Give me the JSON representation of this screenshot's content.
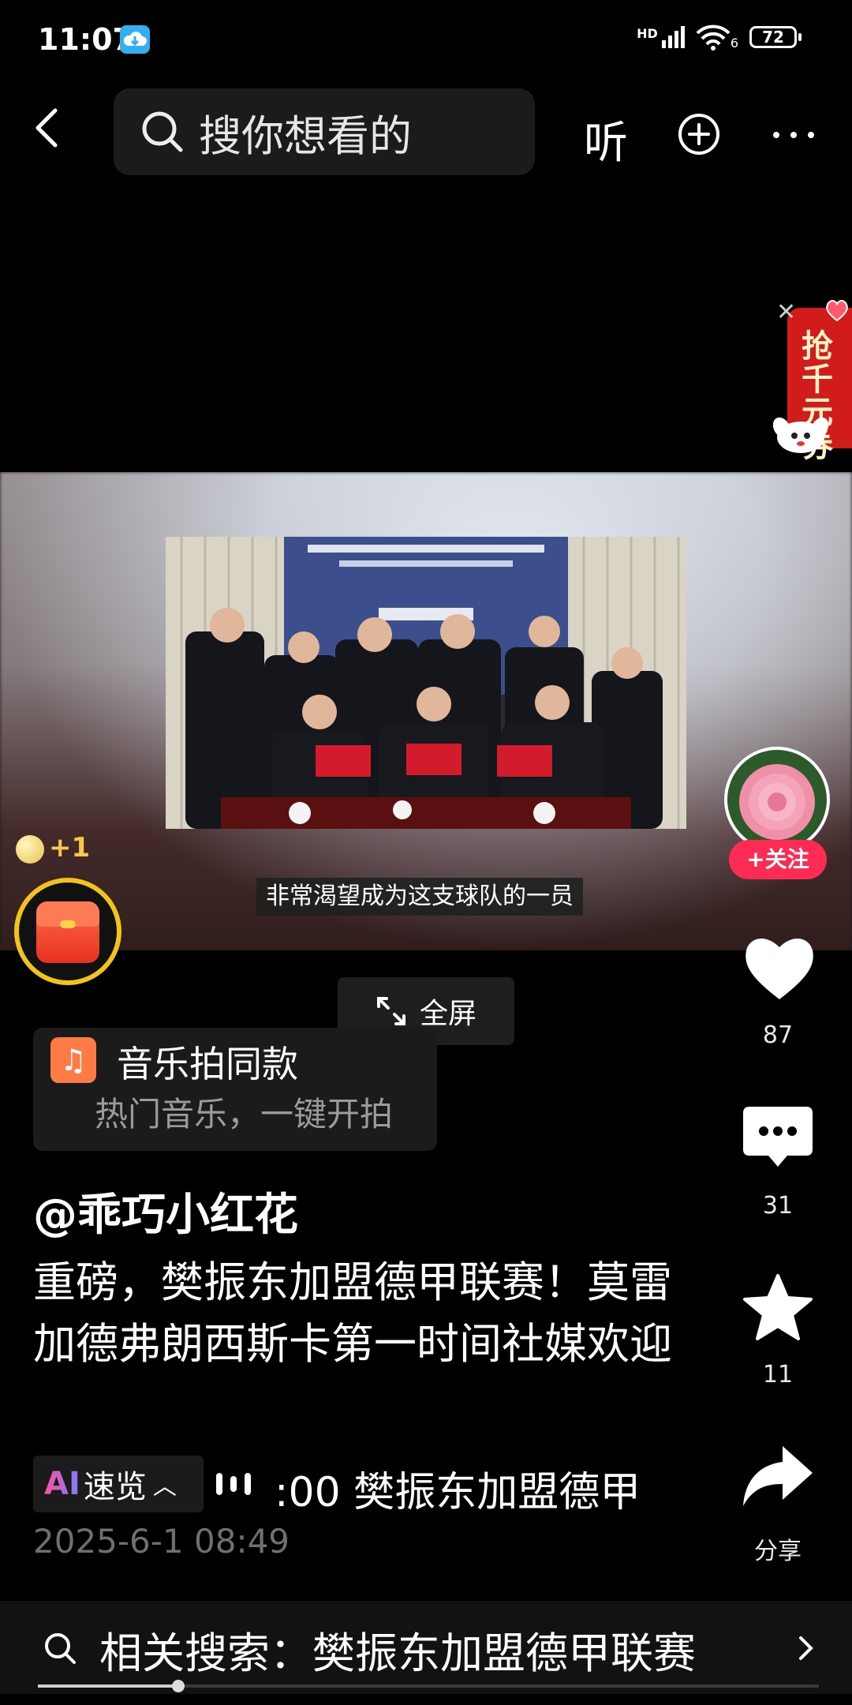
{
  "status_bar": {
    "time": "11:07",
    "network": "HD",
    "signal_extra": "6",
    "battery": "72"
  },
  "top_bar": {
    "search_placeholder": "搜你想看的",
    "listen_label": "听"
  },
  "coupon": {
    "label": "抢千元券"
  },
  "video": {
    "subtitle": "非常渴望成为这支球队的一员",
    "progress": 0.18
  },
  "reward": {
    "coin_label": "+1"
  },
  "author": {
    "follow_label": "+关注",
    "username": "@乖巧小红花"
  },
  "actions": {
    "likes": "87",
    "comments": "31",
    "favorites": "11",
    "share_label": "分享"
  },
  "fullscreen": {
    "label": "全屏"
  },
  "music": {
    "title": "音乐拍同款",
    "subtitle": "热门音乐，一键开拍"
  },
  "post": {
    "description": "重磅，樊振东加盟德甲联赛！莫雷加德弗朗西斯卡第一时间社媒欢迎",
    "ai_label_logo": "AI",
    "ai_label": "速览",
    "marquee": ":00 樊振东加盟德甲",
    "timestamp": "2025-6-1 08:49"
  },
  "related": {
    "label": "相关搜索：樊振东加盟德甲联赛"
  },
  "colors": {
    "accent_red": "#fe2c55",
    "gold": "#f2c41b"
  }
}
